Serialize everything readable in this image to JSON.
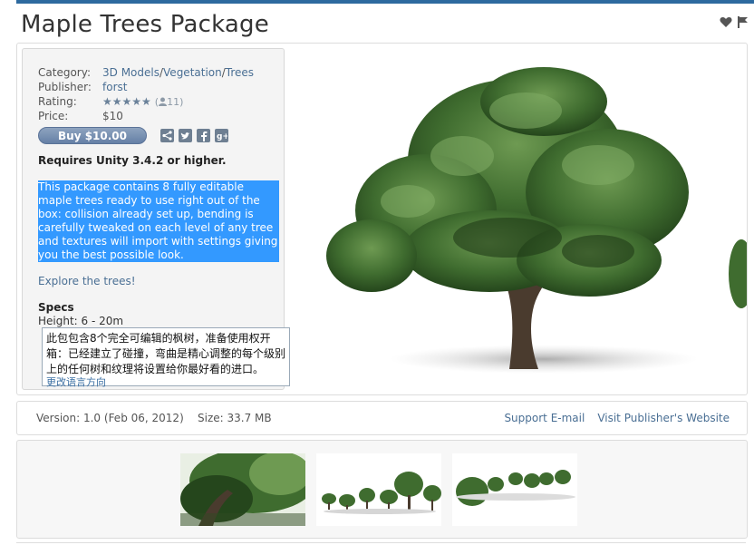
{
  "page": {
    "title": "Maple Trees Package"
  },
  "meta": {
    "category_label": "Category:",
    "category_path": [
      "3D Models",
      "Vegetation",
      "Trees"
    ],
    "category_sep": "/",
    "publisher_label": "Publisher:",
    "publisher": "forst",
    "rating_label": "Rating:",
    "rating_stars": "★★★★★",
    "rating_open": "(",
    "rating_count": "11",
    "rating_close": ")",
    "price_label": "Price:",
    "price": "$10"
  },
  "buy": {
    "label": "Buy $10.00"
  },
  "description": {
    "requirement": "Requires Unity 3.4.2 or higher.",
    "body": "This package contains 8 fully editable maple trees ready to use right out of the box: collision already set up, bending is carefully tweaked on each level of any tree and textures will import with settings giving you the best possible look.",
    "explore": "Explore the trees!",
    "specs_title": "Specs",
    "height": "Height: 6 - 20m"
  },
  "tooltip": {
    "text": "此包包含8个完全可编辑的枫树，准备使用权开箱：已经建立了碰撞，弯曲是精心调整的每个级别上的任何树和纹理将设置给你最好看的进口。",
    "link": "更改语言方向"
  },
  "version": {
    "text": "Version: 1.0 (Feb 06, 2012)",
    "size": "Size: 33.7 MB",
    "support": "Support E-mail",
    "publisher_site": "Visit Publisher's Website"
  },
  "icons": {
    "heart": "heart-icon",
    "flag": "flag-icon",
    "share": "share-icon",
    "twitter": "twitter-icon",
    "facebook": "facebook-icon",
    "gplus": "google-plus-icon",
    "user": "user-icon"
  },
  "colors": {
    "accent": "#2d6a9f",
    "link": "#4a6f94",
    "selection": "#3399ff"
  }
}
